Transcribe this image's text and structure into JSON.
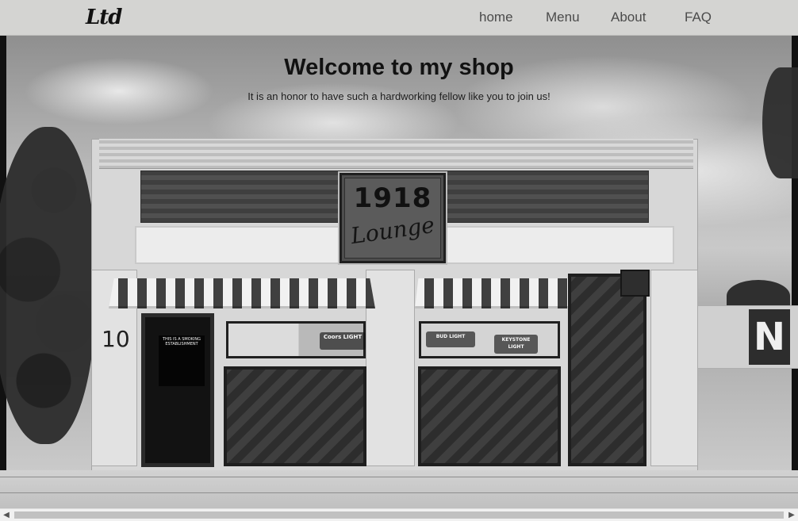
{
  "nav": {
    "brand": "Ltd",
    "links": [
      {
        "label": "home"
      },
      {
        "label": "Menu"
      },
      {
        "label": "About"
      },
      {
        "label": "FAQ"
      }
    ]
  },
  "hero": {
    "title": "Welcome to my shop",
    "subtitle": "It is an honor to have such a hardworking fellow like you to join us!",
    "photo": {
      "address_number": "10",
      "lounge_number": "1918",
      "lounge_word": "Lounge",
      "door_sign_text": "THIS IS A SMOKING ESTABLISHMENT",
      "beer_signs": [
        "Coors LIGHT",
        "BUD LIGHT",
        "KEYSTONE LIGHT"
      ],
      "right_sign_letter": "N"
    }
  },
  "scrollbar": {
    "left_arrow": "◀",
    "right_arrow": "▶"
  },
  "colors": {
    "nav_bg": "#d4d4d2",
    "nav_text": "#4b4b4b",
    "title_text": "#121212",
    "scrollbar_bg": "#f1f1f1",
    "scrollbar_thumb": "#c1c1c1"
  }
}
